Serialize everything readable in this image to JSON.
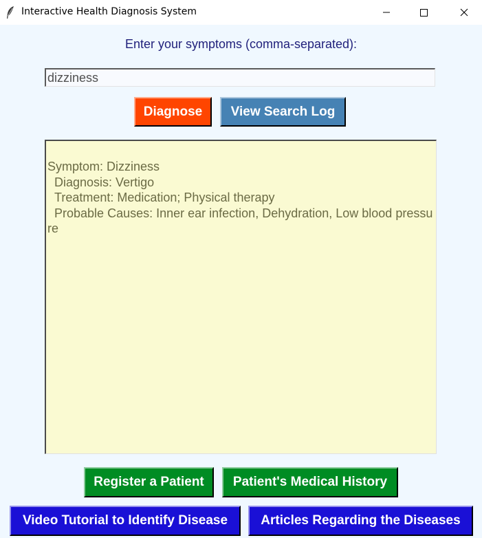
{
  "window": {
    "title": "Interactive Health Diagnosis System",
    "app_icon": "feather-icon",
    "controls": [
      "minimize-icon",
      "maximize-icon",
      "close-icon"
    ]
  },
  "form": {
    "prompt_label": "Enter your symptoms (comma-separated):",
    "symptom_input_value": "dizziness"
  },
  "actions": {
    "diagnose_label": "Diagnose",
    "view_log_label": "View Search Log"
  },
  "result": {
    "lines": [
      "Symptom: Dizziness",
      "  Diagnosis: Vertigo",
      "  Treatment: Medication; Physical therapy",
      "  Probable Causes: Inner ear infection, Dehydration, Low blood pressure"
    ]
  },
  "bottom_buttons": {
    "register_label": "Register a Patient",
    "history_label": "Patient's Medical History",
    "video_label": "Video Tutorial to Identify Disease",
    "articles_label": "Articles Regarding the Diseases"
  },
  "colors": {
    "background": "#F0F8FF",
    "diagnose_button": "#FF4500",
    "view_log_button": "#4682B4",
    "green_button": "#008C23",
    "blue_button": "#1A10D6",
    "result_background": "#FAFAD2",
    "prompt_text": "#1F1F7A"
  }
}
